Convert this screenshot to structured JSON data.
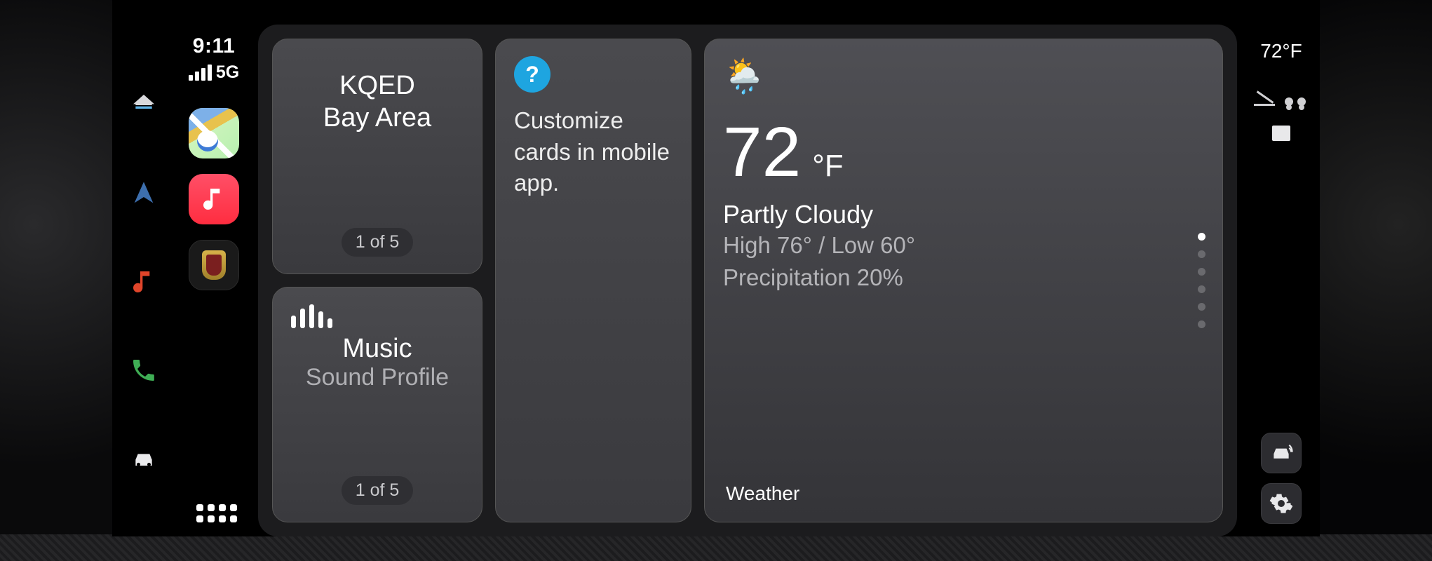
{
  "status": {
    "time": "9:11",
    "network": "5G"
  },
  "left_hw_icons": [
    "home-icon",
    "nav-arrow-icon",
    "music-note-icon",
    "phone-icon",
    "car-icon"
  ],
  "dock_apps": [
    "maps",
    "music",
    "porsche"
  ],
  "cards": {
    "radio": {
      "line1": "KQED",
      "line2": "Bay Area",
      "counter": "1 of 5"
    },
    "tips": {
      "text": "Customize cards in mobile app."
    },
    "music": {
      "title": "Music",
      "subtitle": "Sound Profile",
      "counter": "1 of 5"
    },
    "weather": {
      "temp_value": "72",
      "temp_unit": "°F",
      "condition": "Partly Cloudy",
      "hilo": "High 76° / Low 60°",
      "precip": "Precipitation 20%",
      "attribution": "Weather",
      "page_count": 6,
      "page_active": 0
    }
  },
  "right": {
    "temp": "72°F"
  }
}
